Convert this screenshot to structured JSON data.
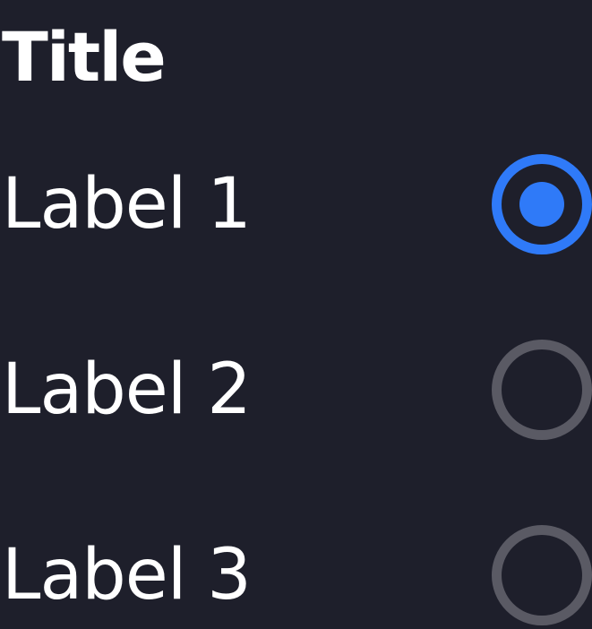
{
  "title": "Title",
  "options": [
    {
      "label": "Label 1",
      "selected": true
    },
    {
      "label": "Label 2",
      "selected": false
    },
    {
      "label": "Label 3",
      "selected": false
    }
  ],
  "colors": {
    "background": "#1e1f2b",
    "text": "#ffffff",
    "accent": "#2f7af8",
    "unselected_ring": "#5a5a64"
  }
}
